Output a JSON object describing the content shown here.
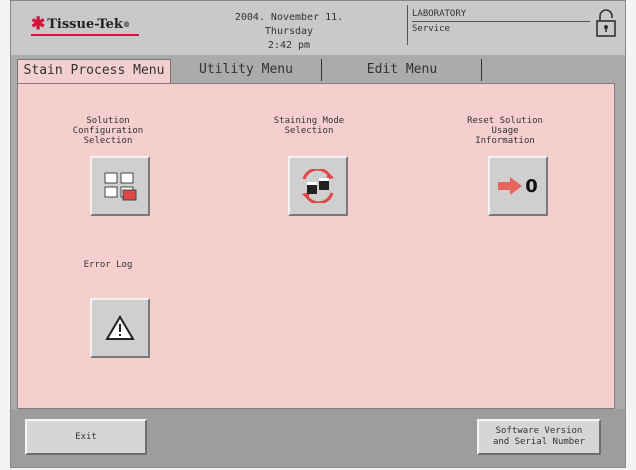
{
  "header": {
    "brand": "Tissue-Tek",
    "brand_mark": "*",
    "brand_reg": "®",
    "date": "2004. November 11. Thursday",
    "time": "2:42 pm",
    "location": "LABORATORY",
    "role": "Service",
    "lock_icon": "padlock-icon"
  },
  "tabs": [
    {
      "label": "Stain Process Menu",
      "active": true
    },
    {
      "label": "Utility Menu",
      "active": false
    },
    {
      "label": "Edit Menu",
      "active": false
    }
  ],
  "items": {
    "solution_config": {
      "label_lines": [
        "Solution",
        "Configuration",
        "Selection"
      ],
      "icon": "solution-config-icon"
    },
    "staining_mode": {
      "label_lines": [
        "Staining Mode",
        "Selection"
      ],
      "icon": "staining-mode-icon"
    },
    "reset_usage": {
      "label_lines": [
        "Reset Solution",
        "Usage",
        "Information"
      ],
      "icon": "reset-arrow-icon",
      "icon_text": "0"
    },
    "error_log": {
      "label_lines": [
        "Error Log"
      ],
      "icon": "warning-triangle-icon"
    }
  },
  "footer": {
    "exit_label": "Exit",
    "software_label_lines": [
      "Software Version",
      "and Serial Number"
    ]
  },
  "colors": {
    "panel_pink": "#f5cece",
    "brand_red": "#d4143a",
    "arrow_red": "#e8655e"
  }
}
